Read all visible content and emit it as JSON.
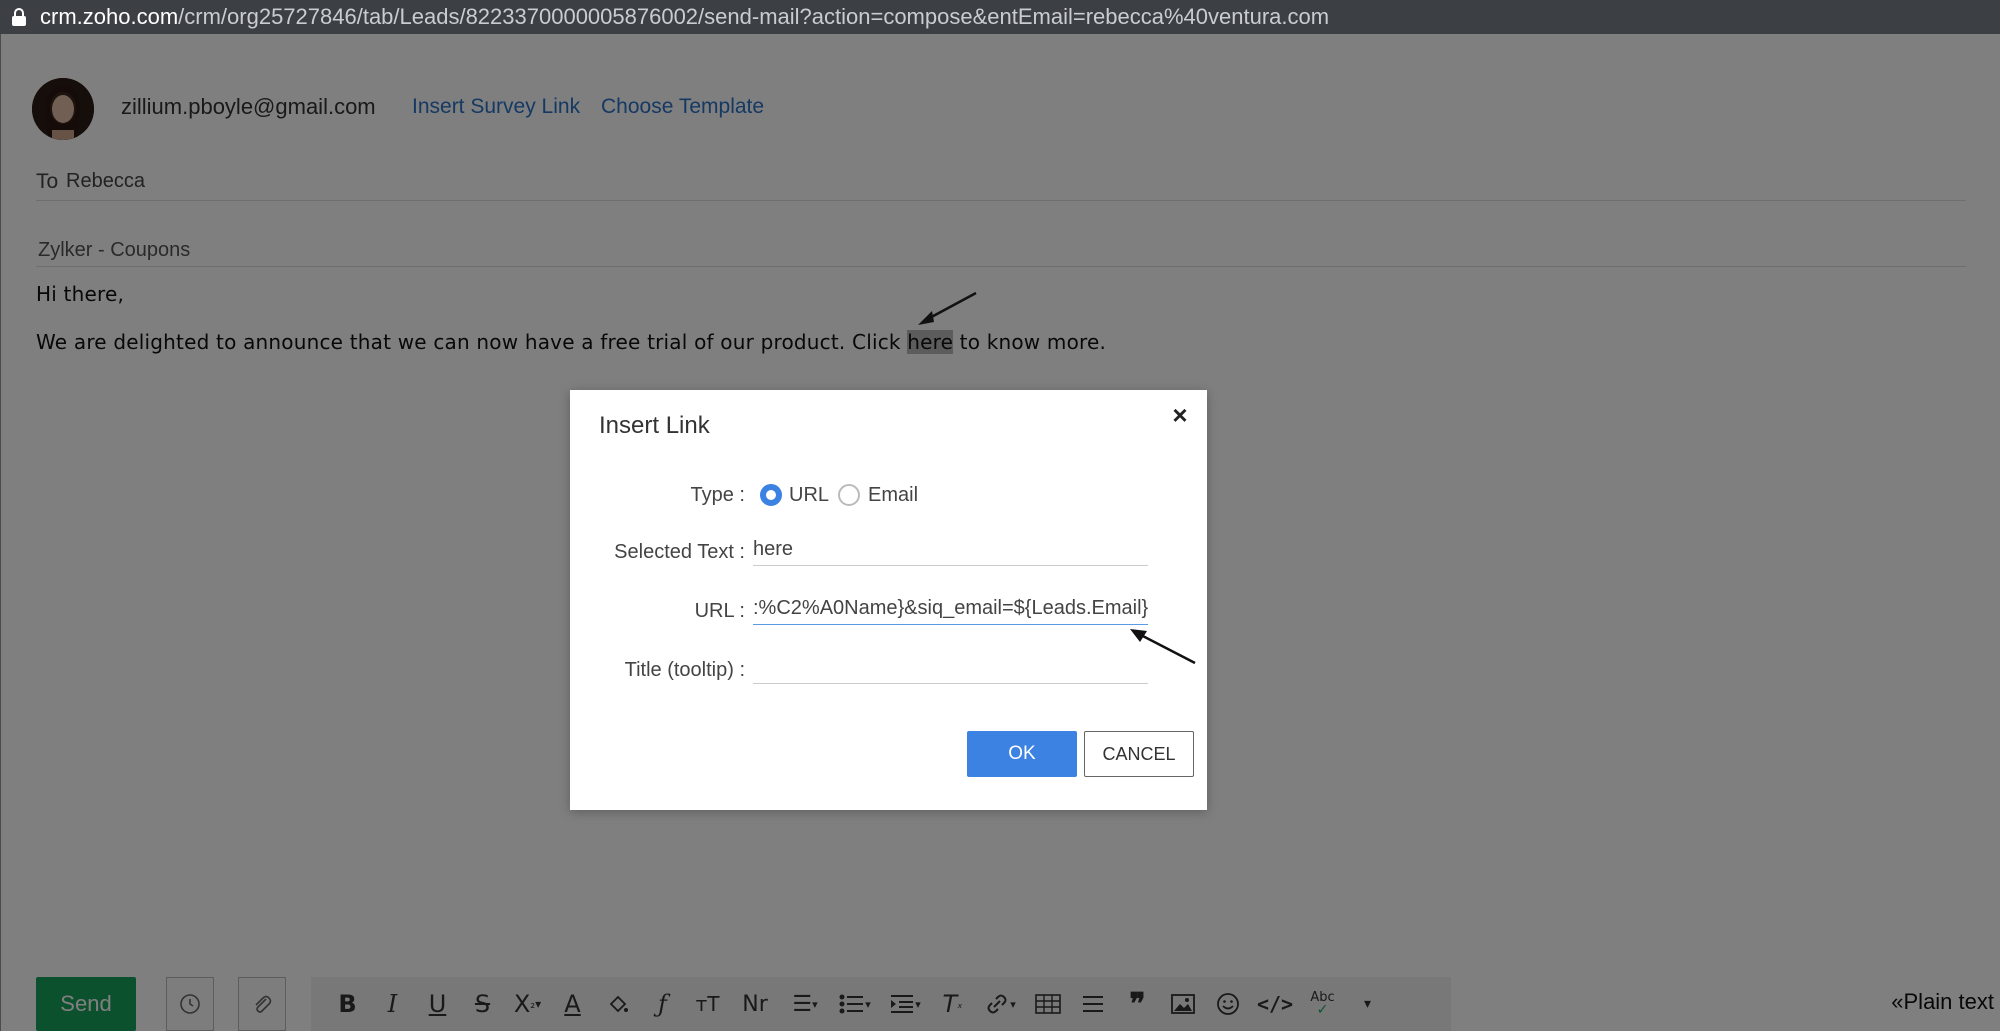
{
  "browser": {
    "url_domain": "crm.zoho.com",
    "url_path": "/crm/org25727846/tab/Leads/8223370000005876002/send-mail?action=compose&entEmail=rebecca%40ventura.com"
  },
  "compose": {
    "from_email": "zillium.pboyle@gmail.com",
    "insert_survey_link": "Insert Survey Link",
    "choose_template": "Choose Template",
    "to_label": "To",
    "to_value": "Rebecca",
    "subject": "Zylker - Coupons",
    "greeting": "Hi there,",
    "body_before": "We are delighted to announce that we can now have a free trial of our product. Click ",
    "body_link": "here",
    "body_after": " to know more."
  },
  "toolbar": {
    "send_label": "Send",
    "plain_text": "«Plain text",
    "icons": [
      "bold-icon",
      "italic-icon",
      "underline-icon",
      "strikethrough-icon",
      "subscript-icon",
      "font-color-icon",
      "fill-color-icon",
      "font-family-icon",
      "font-size-icon",
      "format-icon",
      "align-icon",
      "list-icon",
      "indent-icon",
      "clear-format-icon",
      "link-icon",
      "table-icon",
      "horizontal-line-icon",
      "quote-icon",
      "image-icon",
      "emoji-icon",
      "code-icon",
      "spellcheck-icon",
      "more-icon"
    ]
  },
  "dialog": {
    "title": "Insert Link",
    "type_label": "Type :",
    "type_options": [
      "URL",
      "Email"
    ],
    "type_selected": "URL",
    "selected_text_label": "Selected Text :",
    "selected_text_value": "here",
    "url_label": "URL :",
    "url_value": ":%C2%A0Name}&siq_email=${Leads.Email}",
    "title_label": "Title (tooltip) :",
    "title_value": "",
    "ok_label": "OK",
    "cancel_label": "CANCEL"
  }
}
